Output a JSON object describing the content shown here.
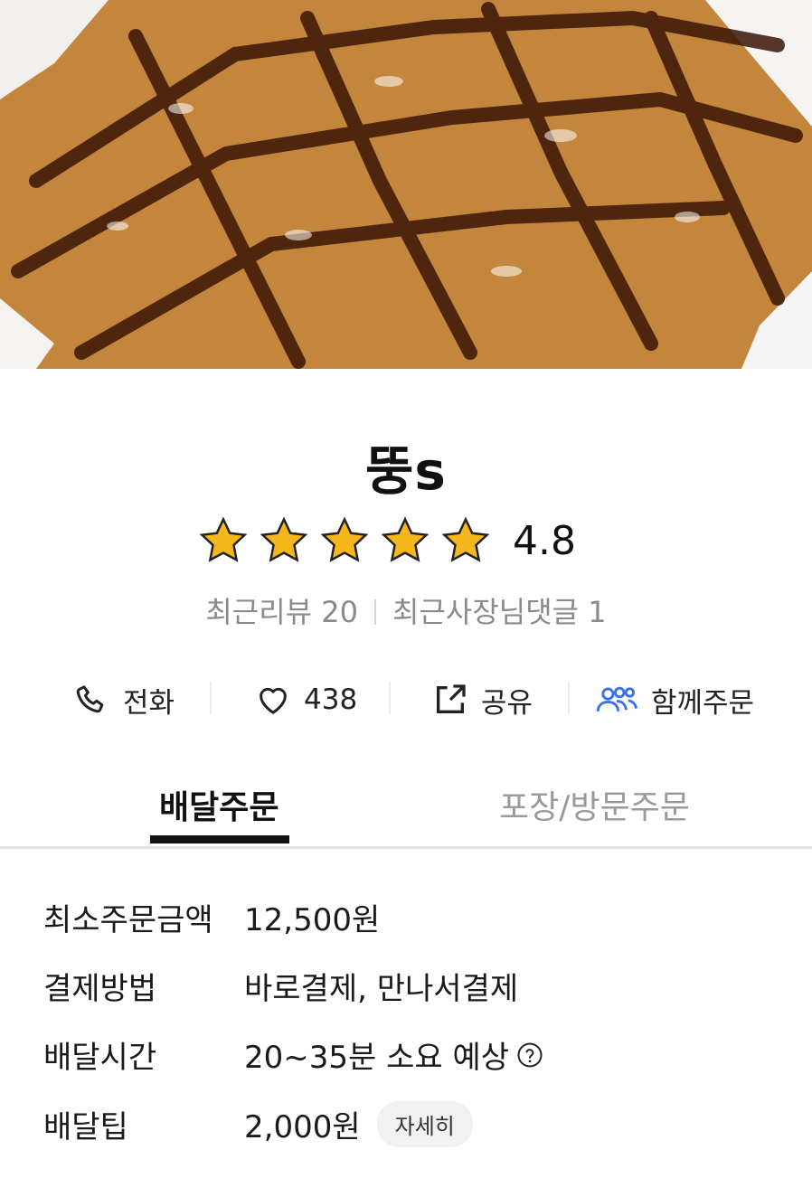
{
  "hero": {
    "image_description": "hero-image"
  },
  "store": {
    "name": "뚱s",
    "rating": "4.8",
    "stars_filled": 5
  },
  "meta": {
    "recent_reviews": "최근리뷰 20",
    "owner_comments": "최근사장님댓글 1"
  },
  "actions": {
    "call": "전화",
    "like_count": "438",
    "share": "공유",
    "group_order": "함께주문"
  },
  "tabs": [
    {
      "label": "배달주문",
      "active": true
    },
    {
      "label": "포장/방문주문",
      "active": false
    }
  ],
  "info": {
    "min_order": {
      "label": "최소주문금액",
      "value": "12,500원"
    },
    "payment": {
      "label": "결제방법",
      "value": "바로결제, 만나서결제"
    },
    "delivery_time": {
      "label": "배달시간",
      "value": "20~35분 소요 예상"
    },
    "delivery_tip": {
      "label": "배달팁",
      "value": "2,000원",
      "detail_button": "자세히"
    }
  },
  "colors": {
    "star": "#f6b71d",
    "group_icon": "#3a6ff0",
    "tab_active": "#111111",
    "muted_text": "#8a8a8a"
  },
  "icons": [
    "phone-icon",
    "heart-icon",
    "share-icon",
    "group-icon",
    "question-icon",
    "star-icon"
  ]
}
